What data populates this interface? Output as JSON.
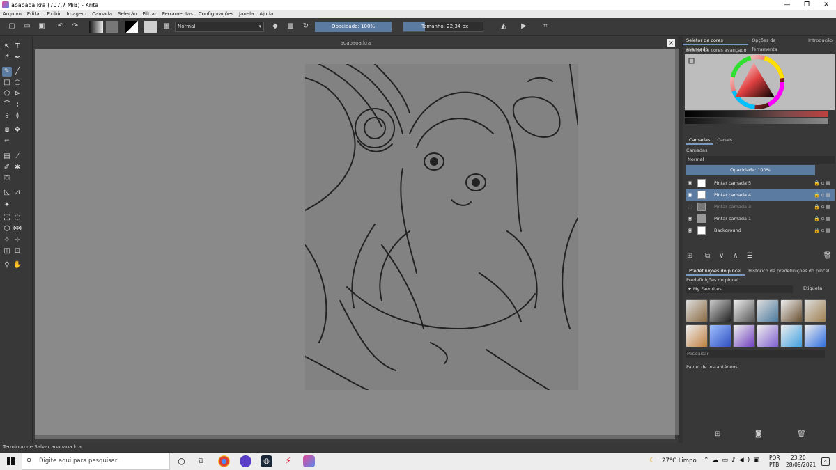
{
  "window": {
    "title": "aoaoaoa.kra (707,7 MiB)  - Krita",
    "controls": [
      "—",
      "❐",
      "✕"
    ]
  },
  "menu": [
    "Arquivo",
    "Editar",
    "Exibir",
    "Imagem",
    "Camada",
    "Seleção",
    "Filtrar",
    "Ferramentas",
    "Configurações",
    "Janela",
    "Ajuda"
  ],
  "toolbar": {
    "blend_mode": "Normal",
    "opacity_label": "Opacidade: 100%",
    "size_label": "Tamanho: 22,34 px",
    "size_fraction": 0.27
  },
  "document": {
    "tab_title": "aoaoaoa.kra",
    "close_glyph": "×"
  },
  "status": {
    "message": "Terminou de Salvar aoaoaoa.kra"
  },
  "right_panel": {
    "top_tabs": [
      "Seletor de cores avançado",
      "Opções da ferramenta",
      "Introdução"
    ],
    "color_selector_title": "Seletor de cores avançado",
    "layer_tabs": [
      "Camadas",
      "Canais"
    ],
    "layers_title": "Camadas",
    "layer_blend": "Normal",
    "layer_opacity": "Opacidade:  100%",
    "layers": [
      {
        "name": "Pintar camada 5",
        "selected": false
      },
      {
        "name": "Pintar camada 4",
        "selected": true
      },
      {
        "name": "Pintar camada 3",
        "selected": false
      },
      {
        "name": "Pintar camada 1",
        "selected": false
      },
      {
        "name": "Background",
        "selected": false
      }
    ],
    "brush_tabs": [
      "Predefinições do pincel",
      "Histórico de predefinições do pincel"
    ],
    "brush_title": "Predefinições do pincel",
    "brush_filter": "★ My Favorites",
    "brush_tag": "Etiqueta",
    "brush_search_placeholder": "Pesquisar",
    "snapshot_title": "Painel de Instantâneos"
  },
  "taskbar": {
    "search_placeholder": "Digite aqui para pesquisar",
    "weather": "27°C  Limpo",
    "lang1": "POR",
    "lang2": "PTB",
    "time": "23:20",
    "date": "28/09/2021",
    "notification_count": "4"
  },
  "colors": {
    "accent": "#5b7ba1",
    "panel": "#383838",
    "canvas_bg": "#8a8a8a"
  }
}
